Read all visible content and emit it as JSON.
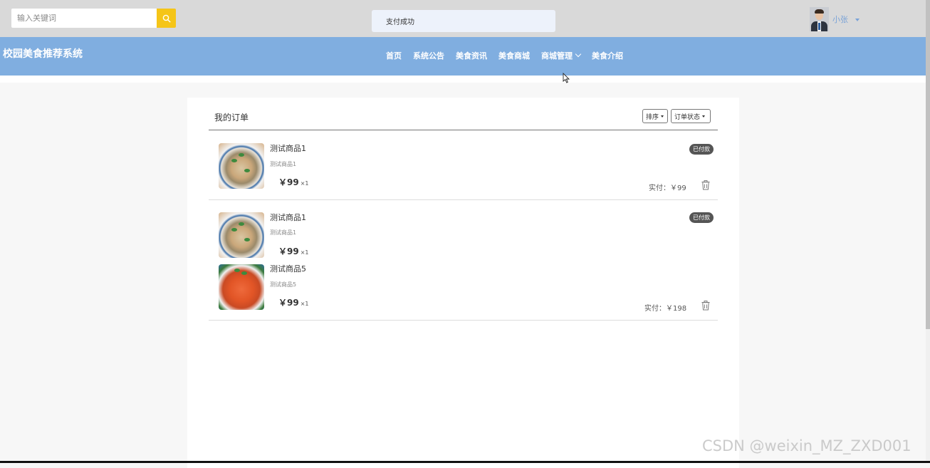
{
  "search": {
    "placeholder": "输入关键词"
  },
  "toast": {
    "message": "支付成功"
  },
  "user": {
    "name": "小张"
  },
  "brand": {
    "title": "校园美食推荐系统"
  },
  "nav": {
    "home": "首页",
    "notice": "系统公告",
    "news": "美食资讯",
    "mall": "美食商城",
    "mall_manage": "商城管理",
    "intro": "美食介绍"
  },
  "orders_page": {
    "title": "我的订单",
    "sort_label": "排序",
    "status_label": "订单状态"
  },
  "orders": [
    {
      "status": "已付款",
      "paid_label": "实付：￥99",
      "items": [
        {
          "name": "测试商品1",
          "desc": "测试商品1",
          "price": "￥99",
          "qty": "×1",
          "image": "soup"
        }
      ]
    },
    {
      "status": "已付款",
      "paid_label": "实付：￥198",
      "items": [
        {
          "name": "测试商品1",
          "desc": "测试商品1",
          "price": "￥99",
          "qty": "×1",
          "image": "soup"
        },
        {
          "name": "测试商品5",
          "desc": "测试商品5",
          "price": "￥99",
          "qty": "×1",
          "image": "shrimp"
        }
      ]
    }
  ],
  "watermark": {
    "text": "CSDN @weixin_MZ_ZXD001"
  },
  "colors": {
    "nav_bg": "#80aee0",
    "search_button": "#f5c518",
    "badge_bg": "#555555"
  }
}
